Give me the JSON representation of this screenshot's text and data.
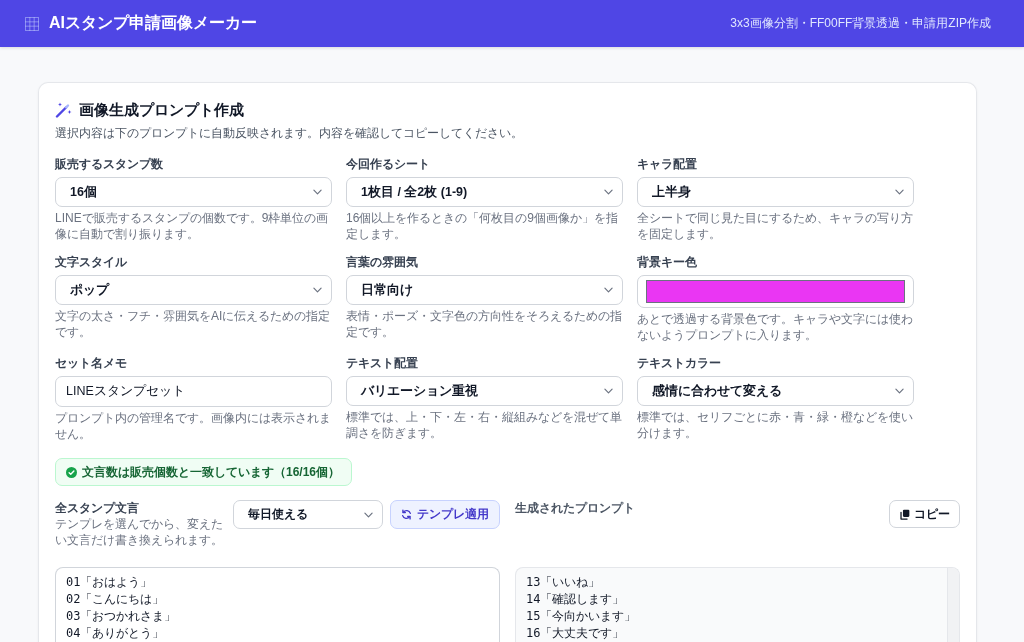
{
  "header": {
    "title": "AIスタンプ申請画像メーカー",
    "tagline": "3x3画像分割・FF00FF背景透過・申請用ZIP作成"
  },
  "prompt_panel": {
    "title": "画像生成プロンプト作成",
    "description": "選択内容は下のプロンプトに自動反映されます。内容を確認してコピーしてください。",
    "fields": [
      {
        "kind": "select",
        "label": "販売するスタンプ数",
        "value": "16個",
        "help": "LINEで販売するスタンプの個数です。9枠単位の画像に自動で割り振ります。"
      },
      {
        "kind": "select",
        "label": "今回作るシート",
        "value": "1枚目 / 全2枚 (1-9)",
        "help": "16個以上を作るときの「何枚目の9個画像か」を指定します。"
      },
      {
        "kind": "select",
        "label": "キャラ配置",
        "value": "上半身",
        "help": "全シートで同じ見た目にするため、キャラの写り方を固定します。"
      },
      {
        "kind": "select",
        "label": "文字スタイル",
        "value": "ポップ",
        "help": "文字の太さ・フチ・雰囲気をAIに伝えるための指定です。"
      },
      {
        "kind": "select",
        "label": "言葉の雰囲気",
        "value": "日常向け",
        "help": "表情・ポーズ・文字色の方向性をそろえるための指定です。"
      },
      {
        "kind": "color",
        "label": "背景キー色",
        "color": "#ea36f3",
        "help": "あとで透過する背景色です。キャラや文字には使わないようプロンプトに入ります。"
      },
      {
        "kind": "text",
        "label": "セット名メモ",
        "value": "LINEスタンプセット",
        "help": "プロンプト内の管理名です。画像内には表示されません。"
      },
      {
        "kind": "select",
        "label": "テキスト配置",
        "value": "バリエーション重視",
        "help": "標準では、上・下・左・右・縦組みなどを混ぜて単調さを防ぎます。"
      },
      {
        "kind": "select",
        "label": "テキストカラー",
        "value": "感情に合わせて変える",
        "help": "標準では、セリフごとに赤・青・緑・橙などを使い分けます。"
      }
    ],
    "status": {
      "kind": "success",
      "text": "文言数は販売個数と一致しています（16/16個）"
    },
    "phrases": {
      "label": "全スタンプ文言",
      "help": "テンプレを選んでから、変えたい文言だけ書き換えられます。",
      "template": "毎日使える",
      "apply_button": "テンプレ適用",
      "lines": [
        "01「おはよう」",
        "02「こんにちは」",
        "03「おつかれさま」",
        "04「ありがとう」"
      ]
    },
    "output": {
      "label": "生成されたプロンプト",
      "copy_button": "コピー",
      "lines": [
        "13「いいね」",
        "14「確認します」",
        "15「今向かいます」",
        "16「大丈夫です」"
      ]
    }
  }
}
